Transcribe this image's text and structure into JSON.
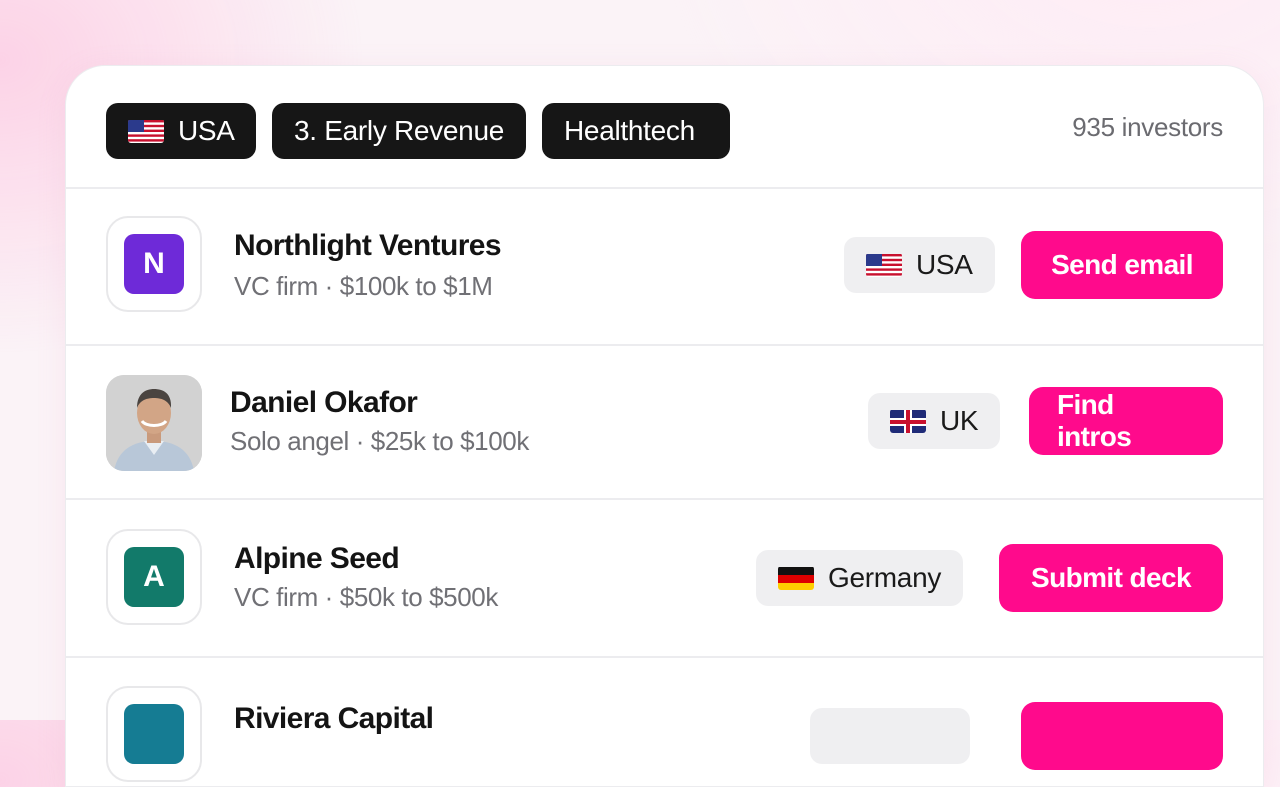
{
  "filters": {
    "country": {
      "label": "USA",
      "flag": "us-flag-icon"
    },
    "stage": {
      "label": "3. Early Revenue"
    },
    "sector": {
      "label": "Healthtech"
    },
    "count_label": "935 investors"
  },
  "investors": [
    {
      "name": "Northlight Ventures",
      "meta": "VC firm · $100k to $1M",
      "logo_letter": "N",
      "logo_color": "#6e2ad8",
      "location": "USA",
      "flag": "us-flag-icon",
      "action": "Send email"
    },
    {
      "name": "Daniel Okafor",
      "meta": "Solo angel · $25k to $100k",
      "avatar": "person-photo",
      "location": "UK",
      "flag": "uk-flag-icon",
      "action": "Find intros"
    },
    {
      "name": "Alpine Seed",
      "meta": "VC firm · $50k to $500k",
      "logo_letter": "A",
      "logo_color": "#127a6a",
      "location": "Germany",
      "flag": "germany-flag-icon",
      "action": "Submit deck"
    },
    {
      "name": "Riviera Capital",
      "logo_color": "#157c93"
    }
  ],
  "colors": {
    "accent": "#ff0a8c",
    "chip_bg": "#161616",
    "location_bg": "#efeff1"
  }
}
